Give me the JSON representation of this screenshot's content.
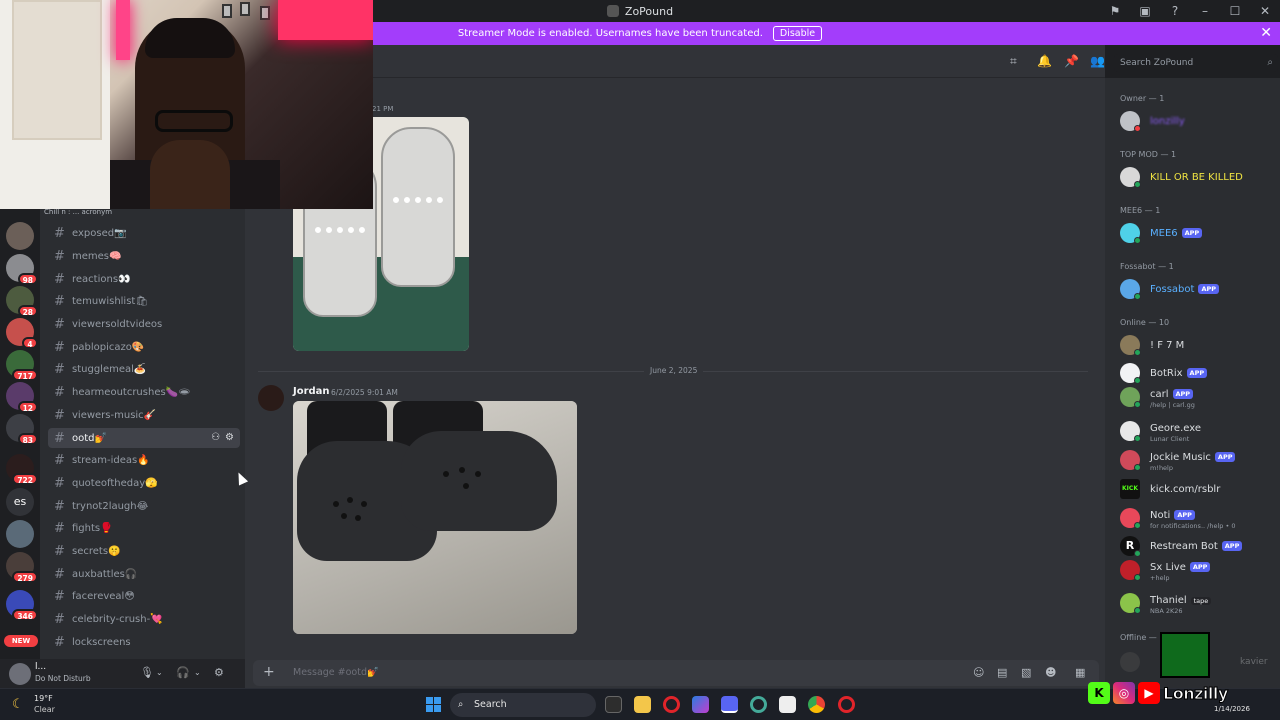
{
  "window": {
    "title": "ZoPound",
    "controls": [
      "minimize",
      "maximize",
      "close"
    ]
  },
  "banner": {
    "text": "Streamer Mode is enabled. Usernames have been truncated.",
    "button": "Disable"
  },
  "servers": {
    "badges": [
      "98",
      "28",
      "4",
      "717",
      "12",
      "83",
      "722",
      "279",
      "346"
    ],
    "text_server": "es",
    "new_label": "NEW"
  },
  "channels": {
    "top_strip": "Chill n : ... acronym",
    "items": [
      {
        "name": "exposed📷"
      },
      {
        "name": "memes🧠"
      },
      {
        "name": "reactions👀"
      },
      {
        "name": "temuwishlist🛍"
      },
      {
        "name": "viewersoldtvideos"
      },
      {
        "name": "pablopicazo🎨"
      },
      {
        "name": "stugglemeal🍝"
      },
      {
        "name": "hearmeoutcrushes🍆🕳"
      },
      {
        "name": "viewers-music🎸"
      },
      {
        "name": "ootd💅"
      },
      {
        "name": "stream-ideas🔥"
      },
      {
        "name": "quoteoftheday🫣"
      },
      {
        "name": "trynot2laugh😂"
      },
      {
        "name": "fights🥊"
      },
      {
        "name": "secrets🤫"
      },
      {
        "name": "auxbattles🎧"
      },
      {
        "name": "facereveal😳"
      },
      {
        "name": "celebrity-crush-💘"
      },
      {
        "name": "lockscreens"
      }
    ],
    "active": "ootd💅"
  },
  "user_panel": {
    "name": "l...",
    "status": "Do Not Disturb"
  },
  "chat": {
    "partial_timestamp": "21 PM",
    "date_divider": "June 2, 2025",
    "message": {
      "author": "Jordan",
      "timestamp": "6/2/2025 9:01 AM"
    },
    "composer_placeholder": "Message #ootd💅"
  },
  "search": {
    "placeholder": "Search ZoPound"
  },
  "members": {
    "groups": {
      "owner": "Owner — 1",
      "top_mod": "TOP MOD — 1",
      "mee6": "MEE6 — 1",
      "fossabot": "Fossabot — 1",
      "online": "Online — 10",
      "offline": "Offline —"
    },
    "owner_name": "lonzilly",
    "top_mod_name": "KILL OR BE KILLED",
    "mee6_name": "MEE6",
    "fossabot_name": "Fossabot",
    "app_tag": "APP",
    "online": [
      {
        "name": "! F 7 M",
        "sub": ""
      },
      {
        "name": "BotRix",
        "sub": "",
        "app": true
      },
      {
        "name": "carl",
        "sub": "/help | carl.gg",
        "app": true
      },
      {
        "name": "Geore.exe",
        "sub": "Lunar Client"
      },
      {
        "name": "Jockie Music",
        "sub": "m!help",
        "app": true
      },
      {
        "name": "kick.com/rsblr",
        "sub": ""
      },
      {
        "name": "Noti",
        "sub": "for notifications.. /help • 0",
        "app": true
      },
      {
        "name": "Restream Bot",
        "sub": "",
        "app": true
      },
      {
        "name": "Sx Live",
        "sub": "+help",
        "app": true
      },
      {
        "name": "Thaniel",
        "sub": "NBA 2K26",
        "tag": "tape"
      }
    ],
    "offline_first": "kavier"
  },
  "taskbar": {
    "temperature": "19°F",
    "condition": "Clear",
    "search": "Search",
    "date": "1/14/2026"
  },
  "overlay": {
    "name": "Lonzilly"
  },
  "colors": {
    "banner": "#a33dfb",
    "owner_name": "#8b5cf6",
    "top_mod_name": "#f0e442",
    "bot_name": "#5ab0ff",
    "app_tag": "#5865f2",
    "online_dot": "#23a55a"
  }
}
